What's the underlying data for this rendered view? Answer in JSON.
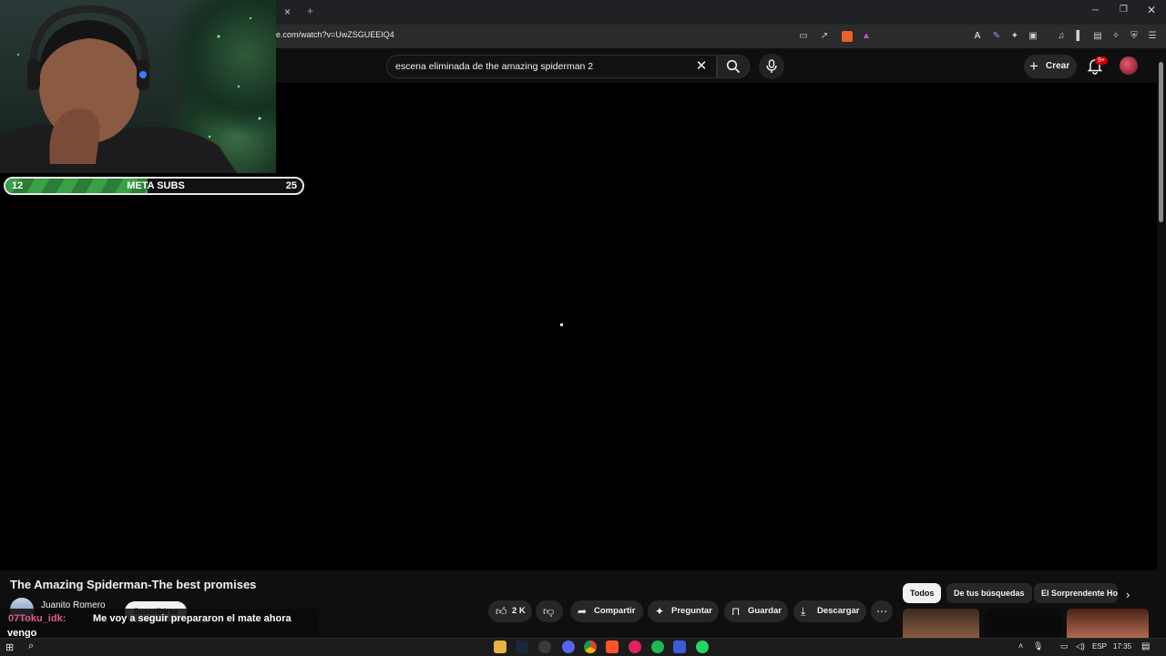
{
  "browser": {
    "url": "e.com/watch?v=UwZSGUEEIQ4",
    "tab_close": "×",
    "new_tab": "+"
  },
  "youtube": {
    "search_value": "escena eliminada de the amazing spiderman 2",
    "create_label": "Crear",
    "notification_count": "9+",
    "video_title": "The Amazing Spiderman-The best promises",
    "channel_name": "Juanito Romero",
    "subscribe_label": "Suscribirse",
    "likes": "2 K",
    "actions": {
      "share": "Compartir",
      "ask": "Preguntar",
      "save": "Guardar",
      "download": "Descargar"
    },
    "chips": [
      "Todos",
      "De tus búsquedas",
      "El Sorprendente Ho"
    ]
  },
  "stream_overlay": {
    "goal_current": "12",
    "goal_label": "META SUBS",
    "goal_target": "25",
    "goal_progress": 0.48,
    "chat_user": "07Toku_idk:",
    "chat_message_line1": "Me voy a seguir prepararon el mate ahora",
    "chat_message_line2": "vengo"
  },
  "taskbar": {
    "language": "ESP",
    "time": "17:35"
  },
  "colors": {
    "background": "#0f0f0f",
    "goal_green": "#3aa046",
    "chat_user": "#e05a8a"
  }
}
